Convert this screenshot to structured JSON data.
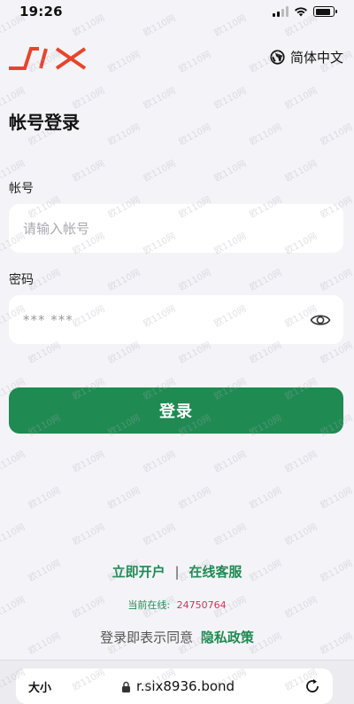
{
  "status": {
    "time": "19:26"
  },
  "header": {
    "logo_text": "SIX",
    "language_label": "简体中文",
    "brand_color": "#e8442c"
  },
  "login": {
    "title": "帐号登录",
    "account_label": "帐号",
    "account_placeholder": "请输入帐号",
    "password_label": "密码",
    "password_value": "*** ***",
    "submit_label": "登录"
  },
  "footer": {
    "register_link": "立即开户",
    "separator": "|",
    "support_link": "在线客服",
    "online_label": "当前在线:",
    "online_count": "24750764",
    "agree_text": "登录即表示同意",
    "privacy_link": "隐私政策"
  },
  "browser": {
    "text_size_label": "大小",
    "url": "r.six8936.bond"
  },
  "watermark_text": "欧110网",
  "colors": {
    "accent": "#1f8a52",
    "count": "#d0345a"
  }
}
